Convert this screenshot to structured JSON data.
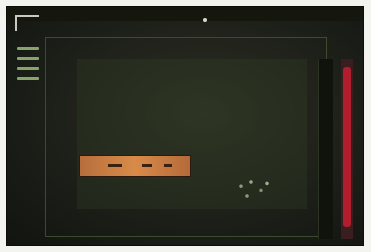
{
  "window": {
    "title": ""
  },
  "sidebar": {
    "items": [
      {
        "icon": "menu-line-icon"
      },
      {
        "icon": "menu-line-icon"
      },
      {
        "icon": "menu-line-icon"
      },
      {
        "icon": "menu-line-icon"
      }
    ]
  },
  "main": {
    "selected_bar_text": "",
    "cluster_label": ""
  },
  "colors": {
    "accent": "#d88b49",
    "scroll_thumb": "#b01e2e",
    "sidebar_icon": "#88a46a"
  }
}
